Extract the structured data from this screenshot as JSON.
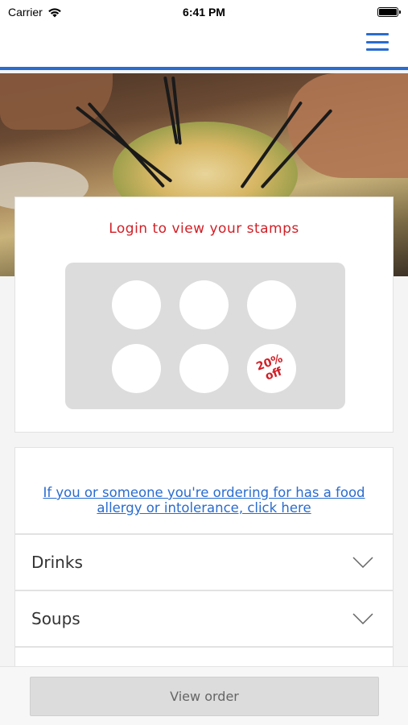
{
  "status_bar": {
    "carrier": "Carrier",
    "time": "6:41 PM"
  },
  "header": {
    "menu_icon": "hamburger-menu-icon",
    "accent_color": "#2a6ccf"
  },
  "stamp_card": {
    "title": "Login to view your stamps",
    "stamps_total": 6,
    "reward_line1": "20%",
    "reward_line2": "off",
    "title_color": "#d21f26"
  },
  "allergy": {
    "link_text": "If you or someone you're ordering for has a food allergy or intolerance, click here"
  },
  "categories": [
    {
      "label": "Drinks"
    },
    {
      "label": "Soups"
    }
  ],
  "footer": {
    "view_order_label": "View order"
  }
}
